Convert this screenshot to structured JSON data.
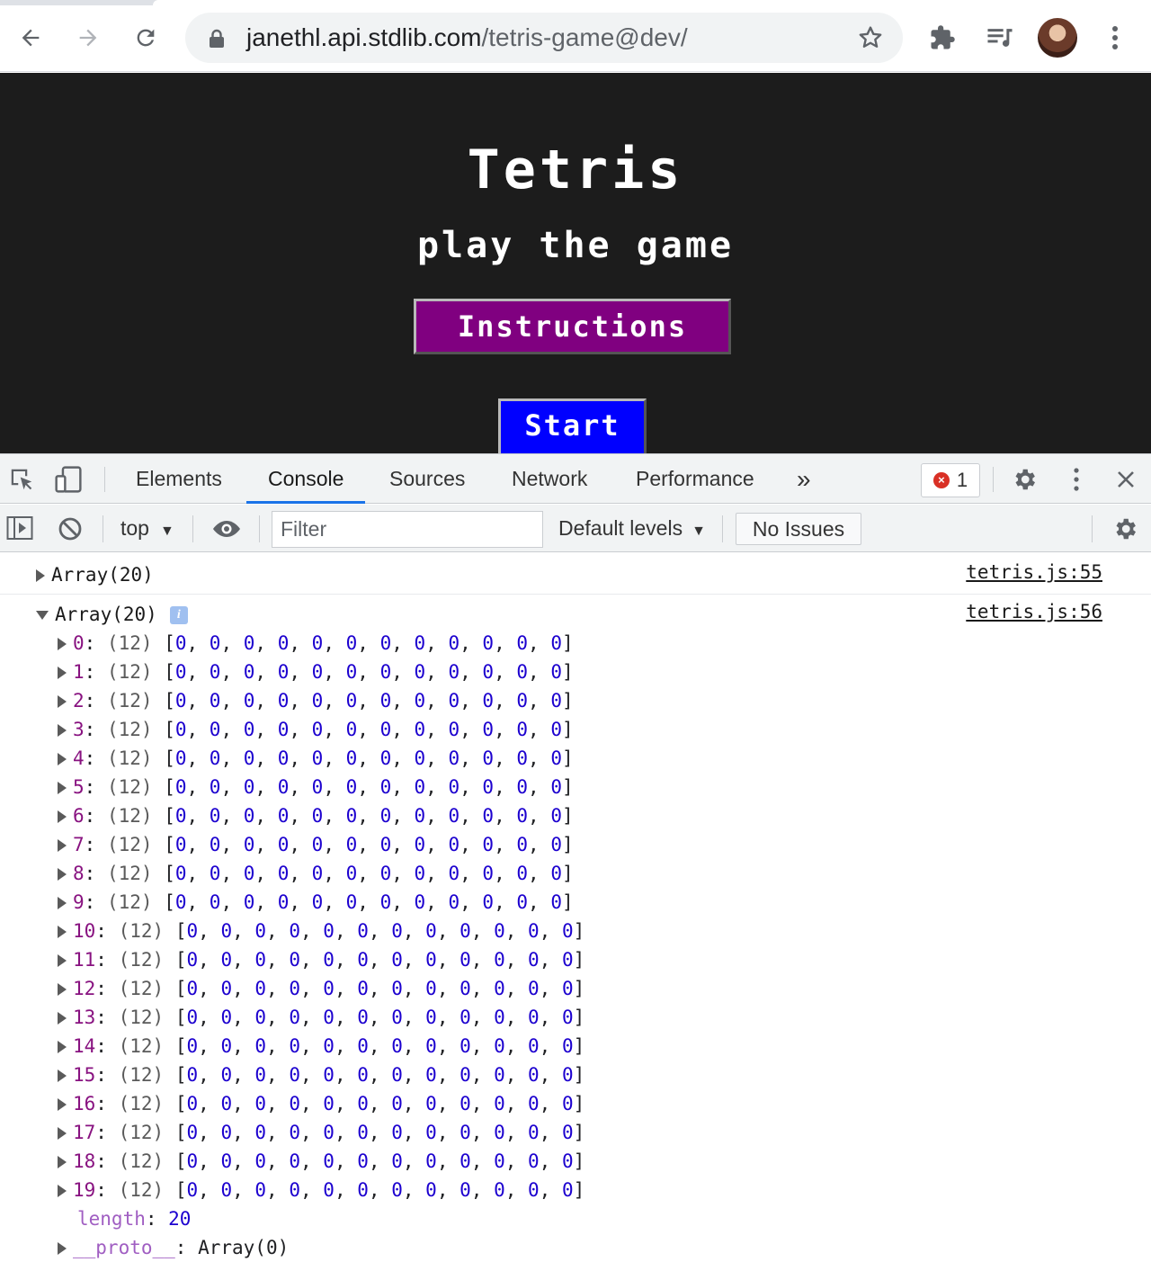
{
  "browser": {
    "url_host": "janethl.api.stdlib.com",
    "url_path": "/tetris-game@dev/"
  },
  "page": {
    "title": "Tetris",
    "subtitle": "play the game",
    "instructions_label": "Instructions",
    "start_label": "Start"
  },
  "devtools": {
    "tabs": [
      "Elements",
      "Console",
      "Sources",
      "Network",
      "Performance"
    ],
    "more_tabs": "»",
    "error_count": "1",
    "context": "top",
    "filter_placeholder": "Filter",
    "levels": "Default levels",
    "issues": "No Issues",
    "console": {
      "msg1": {
        "text": "Array(20)",
        "source": "tetris.js:55"
      },
      "msg2": {
        "text": "Array(20)",
        "source": "tetris.js:56",
        "info": "i",
        "rows": [
          {
            "index": "0",
            "count": "(12)",
            "values": "[0, 0, 0, 0, 0, 0, 0, 0, 0, 0, 0, 0]"
          },
          {
            "index": "1",
            "count": "(12)",
            "values": "[0, 0, 0, 0, 0, 0, 0, 0, 0, 0, 0, 0]"
          },
          {
            "index": "2",
            "count": "(12)",
            "values": "[0, 0, 0, 0, 0, 0, 0, 0, 0, 0, 0, 0]"
          },
          {
            "index": "3",
            "count": "(12)",
            "values": "[0, 0, 0, 0, 0, 0, 0, 0, 0, 0, 0, 0]"
          },
          {
            "index": "4",
            "count": "(12)",
            "values": "[0, 0, 0, 0, 0, 0, 0, 0, 0, 0, 0, 0]"
          },
          {
            "index": "5",
            "count": "(12)",
            "values": "[0, 0, 0, 0, 0, 0, 0, 0, 0, 0, 0, 0]"
          },
          {
            "index": "6",
            "count": "(12)",
            "values": "[0, 0, 0, 0, 0, 0, 0, 0, 0, 0, 0, 0]"
          },
          {
            "index": "7",
            "count": "(12)",
            "values": "[0, 0, 0, 0, 0, 0, 0, 0, 0, 0, 0, 0]"
          },
          {
            "index": "8",
            "count": "(12)",
            "values": "[0, 0, 0, 0, 0, 0, 0, 0, 0, 0, 0, 0]"
          },
          {
            "index": "9",
            "count": "(12)",
            "values": "[0, 0, 0, 0, 0, 0, 0, 0, 0, 0, 0, 0]"
          },
          {
            "index": "10",
            "count": "(12)",
            "values": "[0, 0, 0, 0, 0, 0, 0, 0, 0, 0, 0, 0]"
          },
          {
            "index": "11",
            "count": "(12)",
            "values": "[0, 0, 0, 0, 0, 0, 0, 0, 0, 0, 0, 0]"
          },
          {
            "index": "12",
            "count": "(12)",
            "values": "[0, 0, 0, 0, 0, 0, 0, 0, 0, 0, 0, 0]"
          },
          {
            "index": "13",
            "count": "(12)",
            "values": "[0, 0, 0, 0, 0, 0, 0, 0, 0, 0, 0, 0]"
          },
          {
            "index": "14",
            "count": "(12)",
            "values": "[0, 0, 0, 0, 0, 0, 0, 0, 0, 0, 0, 0]"
          },
          {
            "index": "15",
            "count": "(12)",
            "values": "[0, 0, 0, 0, 0, 0, 0, 0, 0, 0, 0, 0]"
          },
          {
            "index": "16",
            "count": "(12)",
            "values": "[0, 0, 0, 0, 0, 0, 0, 0, 0, 0, 0, 0]"
          },
          {
            "index": "17",
            "count": "(12)",
            "values": "[0, 0, 0, 0, 0, 0, 0, 0, 0, 0, 0, 0]"
          },
          {
            "index": "18",
            "count": "(12)",
            "values": "[0, 0, 0, 0, 0, 0, 0, 0, 0, 0, 0, 0]"
          },
          {
            "index": "19",
            "count": "(12)",
            "values": "[0, 0, 0, 0, 0, 0, 0, 0, 0, 0, 0, 0]"
          }
        ],
        "length_key": "length",
        "length_value": "20",
        "proto_key": "__proto__",
        "proto_value": "Array(0)"
      }
    }
  }
}
